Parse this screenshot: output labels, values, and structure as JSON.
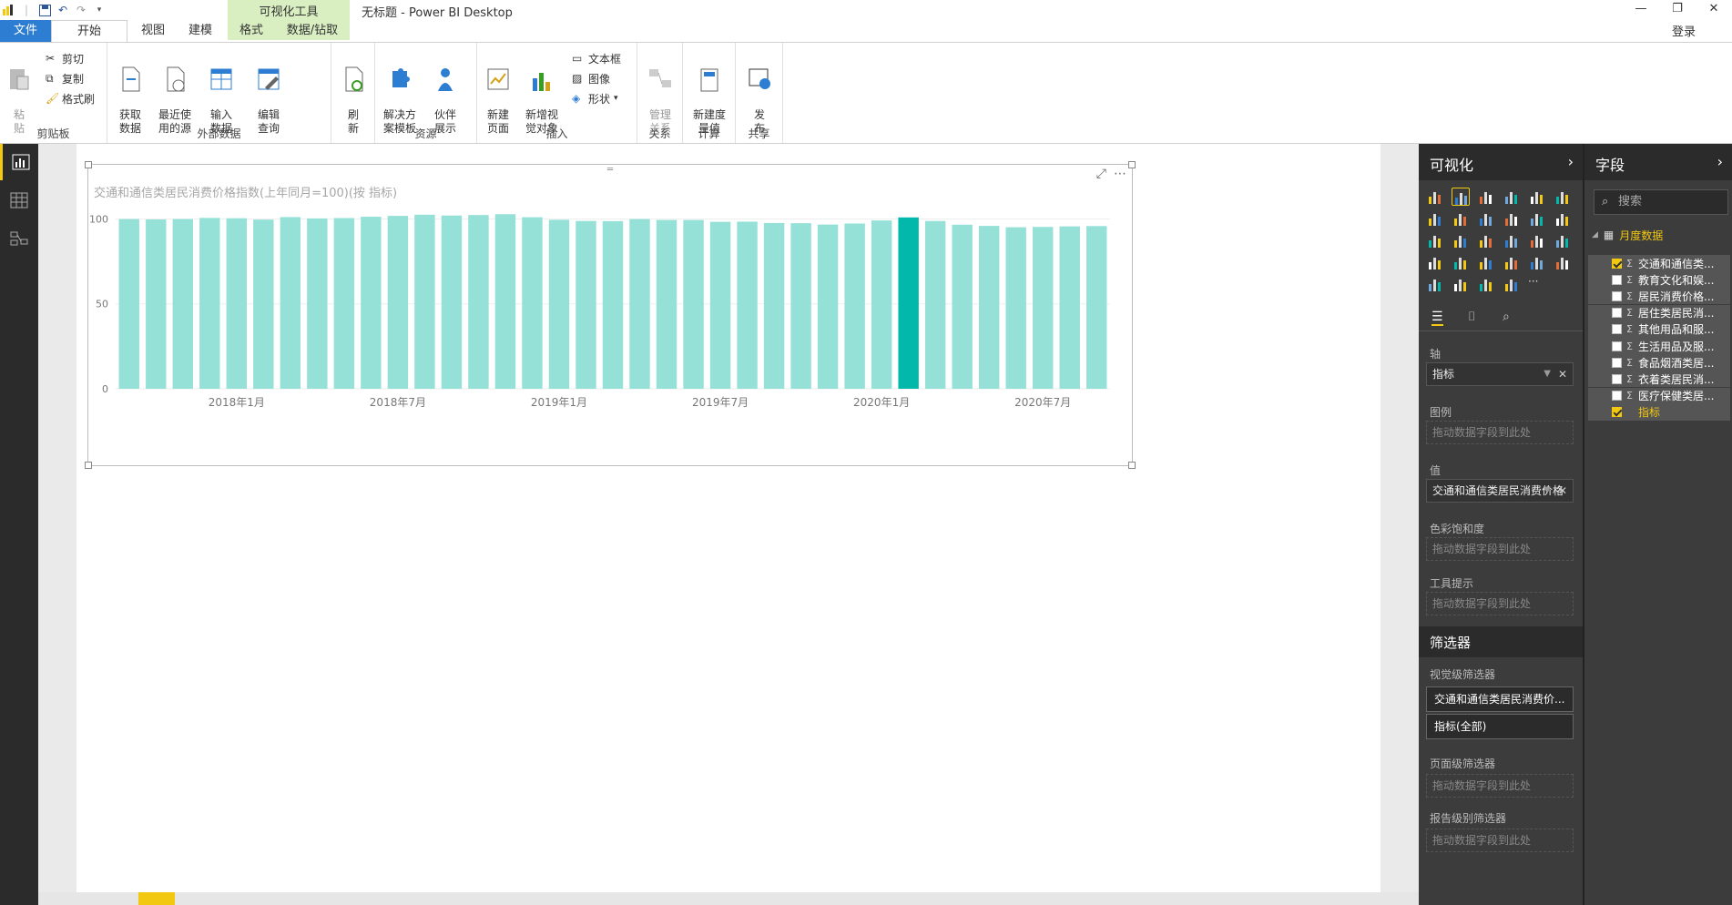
{
  "window": {
    "title": "无标题 - Power BI Desktop",
    "contextual_tab": "可视化工具",
    "login": "登录"
  },
  "tabs": [
    "文件",
    "开始",
    "视图",
    "建模",
    "格式",
    "数据/钻取"
  ],
  "ribbon": {
    "clipboard": {
      "label": "剪贴板",
      "paste": "粘\n贴",
      "cut": "剪切",
      "copy": "复制",
      "format_painter": "格式刷"
    },
    "external": {
      "label": "外部数据",
      "get_data": "获取\n数据",
      "recent": "最近使\n用的源",
      "enter_data": "输入\n数据",
      "edit_queries": "编辑\n查询"
    },
    "refresh": "刷\n新",
    "resources": {
      "label": "资源",
      "solution_templates": "解决方\n案模板",
      "partner": "伙伴\n展示"
    },
    "insert": {
      "label": "插入",
      "new_page": "新建\n页面",
      "new_visual": "新增视\n觉对象",
      "textbox": "文本框",
      "image": "图像",
      "shapes": "形状"
    },
    "relationships": {
      "label": "关系",
      "manage": "管理\n关系"
    },
    "calculations": {
      "label": "计算",
      "new_measure": "新建度\n量值"
    },
    "share": {
      "label": "共享",
      "publish": "发\n布"
    }
  },
  "chart_data": {
    "type": "bar",
    "title": "交通和通信类居民消费价格指数(上年同月=100)(按 指标)",
    "x_tick_labels": [
      "2018年1月",
      "2018年7月",
      "2019年1月",
      "2019年7月",
      "2020年1月",
      "2020年7月"
    ],
    "y_ticks": [
      0,
      50,
      100
    ],
    "ylim": [
      0,
      104
    ],
    "values": [
      99.9,
      99.7,
      99.9,
      100.6,
      100.4,
      99.6,
      101.1,
      100.3,
      100.5,
      101.3,
      101.8,
      102.5,
      102.0,
      102.3,
      102.8,
      101.0,
      99.5,
      98.8,
      98.7,
      99.9,
      99.4,
      99.4,
      98.3,
      98.4,
      97.6,
      97.5,
      96.7,
      97.3,
      99.1,
      100.9,
      98.8,
      96.6,
      95.9,
      95.1,
      95.3,
      95.6,
      95.8
    ],
    "highlight_index": 29,
    "colors": {
      "bar": "#95e1d8",
      "highlight": "#01b8aa",
      "grid": "#eeeeee",
      "tick": "#777777"
    }
  },
  "viz_pane": {
    "title": "可视化",
    "sections": {
      "axis": "轴",
      "axis_value": "指标",
      "legend": "图例",
      "value": "值",
      "value_field": "交通和通信类居民消费价格",
      "saturation": "色彩饱和度",
      "tooltip": "工具提示",
      "drop_hint": "拖动数据字段到此处"
    },
    "filters": {
      "title": "筛选器",
      "visual_level": "视觉级筛选器",
      "card1": "交通和通信类居民消费价...",
      "card2": "指标(全部)",
      "page_level": "页面级筛选器",
      "report_level": "报告级别筛选器",
      "drop_hint": "拖动数据字段到此处"
    }
  },
  "fields_pane": {
    "title": "字段",
    "search_placeholder": "搜索",
    "table": "月度数据",
    "fields": [
      {
        "name": "交通和通信类...",
        "checked": true,
        "sigma": true
      },
      {
        "name": "教育文化和娱...",
        "checked": false,
        "sigma": true
      },
      {
        "name": "居民消费价格...",
        "checked": false,
        "sigma": true
      },
      {
        "name": "居住类居民消...",
        "checked": false,
        "sigma": true
      },
      {
        "name": "其他用品和服...",
        "checked": false,
        "sigma": true
      },
      {
        "name": "生活用品及服...",
        "checked": false,
        "sigma": true
      },
      {
        "name": "食品烟酒类居...",
        "checked": false,
        "sigma": true
      },
      {
        "name": "衣着类居民消...",
        "checked": false,
        "sigma": true
      },
      {
        "name": "医疗保健类居...",
        "checked": false,
        "sigma": true
      },
      {
        "name": "指标",
        "checked": true,
        "sigma": false
      }
    ]
  }
}
